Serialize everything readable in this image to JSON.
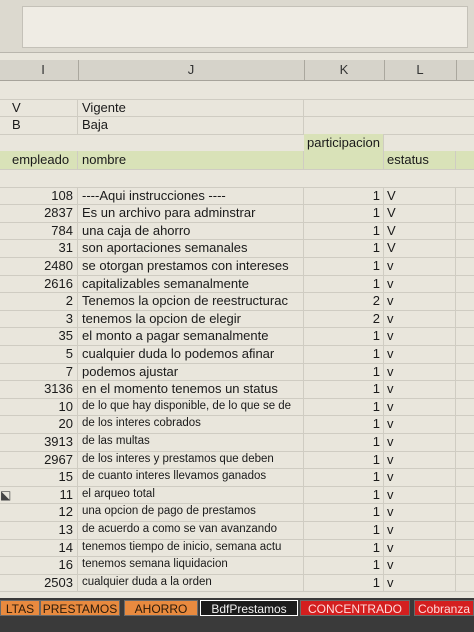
{
  "columns": [
    "I",
    "J",
    "K",
    "L"
  ],
  "legend": [
    {
      "code": "V",
      "meaning": "Vigente"
    },
    {
      "code": "B",
      "meaning": "Baja"
    }
  ],
  "headers": {
    "participacion": "participacion",
    "empleado": "empleado",
    "nombre": "nombre",
    "estatus": "estatus"
  },
  "rows": [
    {
      "empleado": "108",
      "nombre": "----Aqui instrucciones ----",
      "participacion": "1",
      "estatus": "V"
    },
    {
      "empleado": "2837",
      "nombre": "Es un archivo para adminstrar",
      "participacion": "1",
      "estatus": "V"
    },
    {
      "empleado": "784",
      "nombre": "una caja de ahorro",
      "participacion": "1",
      "estatus": "V"
    },
    {
      "empleado": "31",
      "nombre": "son aportaciones semanales",
      "participacion": "1",
      "estatus": "V"
    },
    {
      "empleado": "2480",
      "nombre": "se otorgan prestamos con intereses",
      "participacion": "1",
      "estatus": "v"
    },
    {
      "empleado": "2616",
      "nombre": "capitalizables semanalmente",
      "participacion": "1",
      "estatus": "v"
    },
    {
      "empleado": "2",
      "nombre": "Tenemos la  opcion de reestructurac",
      "participacion": "2",
      "estatus": "v"
    },
    {
      "empleado": "3",
      "nombre": "tenemos la opcion de elegir",
      "participacion": "2",
      "estatus": "v"
    },
    {
      "empleado": "35",
      "nombre": "el monto a pagar semanalmente",
      "participacion": "1",
      "estatus": "v"
    },
    {
      "empleado": "5",
      "nombre": "cualquier duda lo podemos afinar",
      "participacion": "1",
      "estatus": "v"
    },
    {
      "empleado": "7",
      "nombre": "podemos ajustar",
      "participacion": "1",
      "estatus": "v"
    },
    {
      "empleado": "3136",
      "nombre": "en el momento tenemos un status",
      "participacion": "1",
      "estatus": "v"
    },
    {
      "empleado": "10",
      "nombre": "de lo que hay disponible, de lo que se de",
      "participacion": "1",
      "estatus": "v"
    },
    {
      "empleado": "20",
      "nombre": "de los interes cobrados",
      "participacion": "1",
      "estatus": "v"
    },
    {
      "empleado": "3913",
      "nombre": "de las multas",
      "participacion": "1",
      "estatus": "v"
    },
    {
      "empleado": "2967",
      "nombre": "de los interes y prestamos que deben",
      "participacion": "1",
      "estatus": "v"
    },
    {
      "empleado": "15",
      "nombre": "de cuanto interes llevamos ganados",
      "participacion": "1",
      "estatus": "v"
    },
    {
      "empleado": "11",
      "nombre": "el arqueo total",
      "participacion": "1",
      "estatus": "v"
    },
    {
      "empleado": "12",
      "nombre": "una opcion de pago de prestamos",
      "participacion": "1",
      "estatus": "v"
    },
    {
      "empleado": "13",
      "nombre": "de acuerdo a como se van avanzando",
      "participacion": "1",
      "estatus": "v"
    },
    {
      "empleado": "14",
      "nombre": "tenemos tiempo de inicio, semana actu",
      "participacion": "1",
      "estatus": "v"
    },
    {
      "empleado": "16",
      "nombre": "tenemos semana liquidacion",
      "participacion": "1",
      "estatus": "v"
    },
    {
      "empleado": "2503",
      "nombre": "cualquier duda a la orden",
      "participacion": "1",
      "estatus": "v"
    }
  ],
  "sheet_tabs": [
    {
      "label": "LTAS",
      "color": "#e88a3f"
    },
    {
      "label": "PRESTAMOS",
      "color": "#e88a3f"
    },
    {
      "label": "AHORRO",
      "color": "#e88a3f"
    },
    {
      "label": "BdfPrestamos",
      "color": "#1b1b1b"
    },
    {
      "label": "CONCENTRADO",
      "color": "#d41f1f"
    },
    {
      "label": "Cobranza",
      "color": "#d41f1f"
    }
  ],
  "active_tab": "BdfPrestamos"
}
